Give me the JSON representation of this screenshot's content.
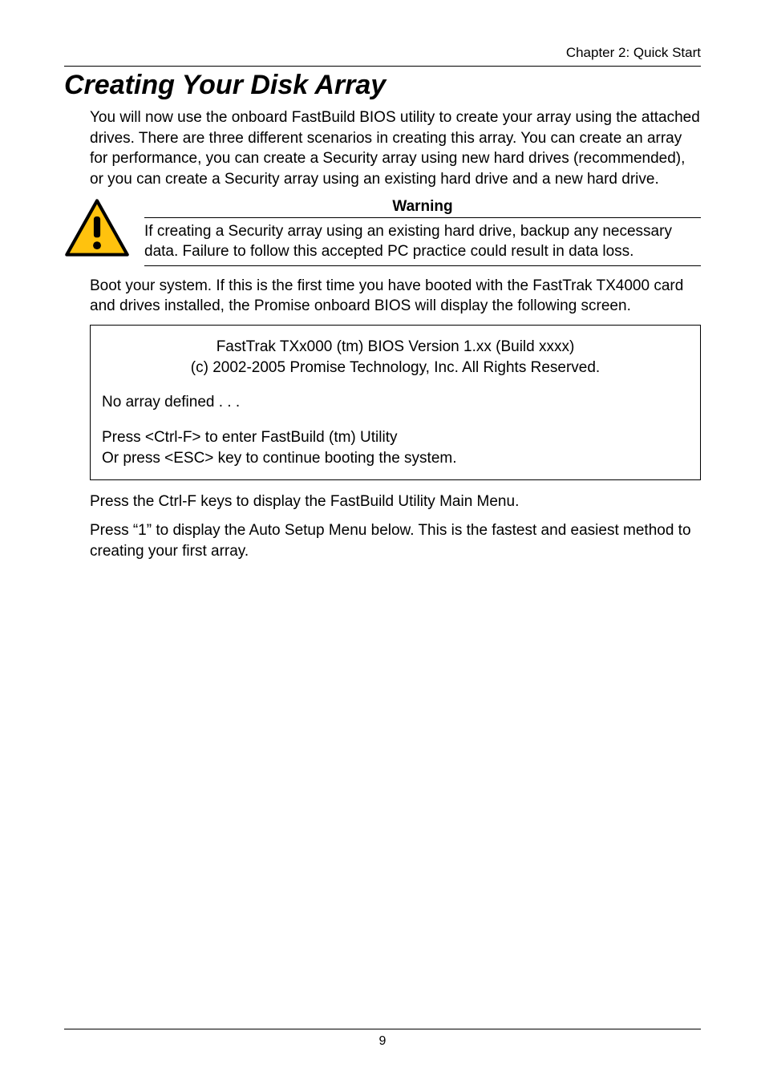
{
  "header": {
    "chapter": "Chapter 2: Quick Start"
  },
  "h1": "Creating Your Disk Array",
  "intro": "You will now use the onboard FastBuild BIOS utility to create your array using the attached drives. There are three different scenarios in creating this array. You can create an array for performance, you can create a Security array using new hard drives (recommended), or you can create a Security array using an existing hard drive and a new hard drive.",
  "warning": {
    "title": "Warning",
    "body": "If creating a Security array using an existing hard drive, backup any necessary data. Failure to follow this accepted PC practice could result in data loss.",
    "icon_name": "warning-triangle-icon"
  },
  "after_warning": "Boot your system. If this is the first time you have booted with the FastTrak TX4000 card and drives installed, the Promise onboard BIOS will display the following screen.",
  "bios": {
    "line1": "FastTrak TXx000 (tm) BIOS Version 1.xx (Build xxxx)",
    "line2": "(c) 2002-2005 Promise Technology, Inc. All Rights Reserved.",
    "no_array": "No array defined . . .",
    "press_ctrlf": "Press <Ctrl-F> to enter FastBuild (tm) Utility",
    "press_esc": "Or press <ESC> key to continue booting the system."
  },
  "after_bios_1": "Press the Ctrl-F keys to display the FastBuild Utility Main Menu.",
  "after_bios_2": "Press “1” to display the Auto Setup Menu below. This is the fastest and easiest method to creating your first array.",
  "footer": {
    "page": "9"
  }
}
